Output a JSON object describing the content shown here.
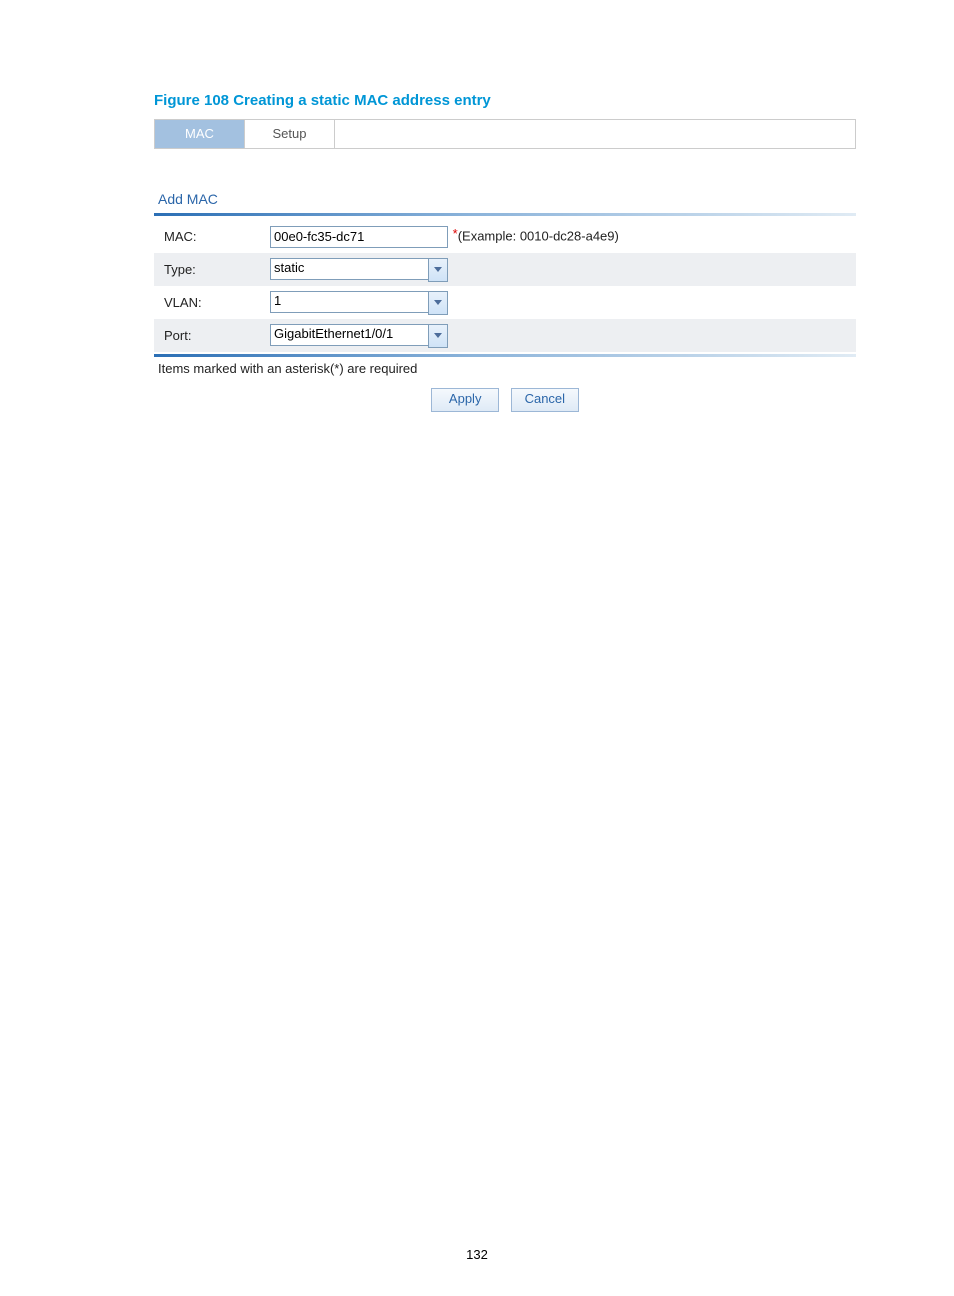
{
  "figure": {
    "caption": "Figure 108 Creating a static MAC address entry"
  },
  "tabs": {
    "mac": "MAC",
    "setup": "Setup"
  },
  "section": {
    "title": "Add MAC"
  },
  "form": {
    "mac_label": "MAC:",
    "mac_value": "00e0-fc35-dc71",
    "mac_example": "(Example: 0010-dc28-a4e9)",
    "type_label": "Type:",
    "type_value": "static",
    "vlan_label": "VLAN:",
    "vlan_value": "1",
    "port_label": "Port:",
    "port_value": "GigabitEthernet1/0/1"
  },
  "required_note": "Items marked with an asterisk(*) are required",
  "buttons": {
    "apply": "Apply",
    "cancel": "Cancel"
  },
  "page_number": "132"
}
